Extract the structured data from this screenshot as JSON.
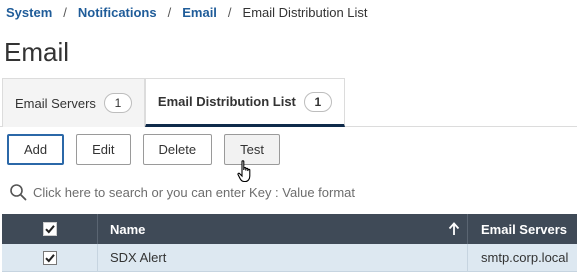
{
  "breadcrumb": {
    "items": [
      "System",
      "Notifications",
      "Email"
    ],
    "separator": "/",
    "current": "Email Distribution List"
  },
  "page": {
    "title": "Email"
  },
  "tabs": [
    {
      "label": "Email Servers",
      "count": "1",
      "active": false
    },
    {
      "label": "Email Distribution List",
      "count": "1",
      "active": true
    }
  ],
  "toolbar": {
    "add_label": "Add",
    "edit_label": "Edit",
    "delete_label": "Delete",
    "test_label": "Test"
  },
  "search": {
    "placeholder": "Click here to search or you can enter Key : Value format",
    "value": "",
    "icon": "search-icon"
  },
  "table": {
    "columns": [
      "Name",
      "Email Servers"
    ],
    "sort_column": "Name",
    "sort_direction": "ascending",
    "header_checked": true,
    "rows": [
      {
        "checked": true,
        "name": "SDX Alert",
        "email_servers": "smtp.corp.local"
      }
    ]
  },
  "colors": {
    "link": "#1f5c99",
    "table_header_bg": "#3f4a57",
    "selected_row_bg": "#dde8f1",
    "active_tab_underline": "#0f2a4a",
    "focus_border": "#2b68a8"
  }
}
